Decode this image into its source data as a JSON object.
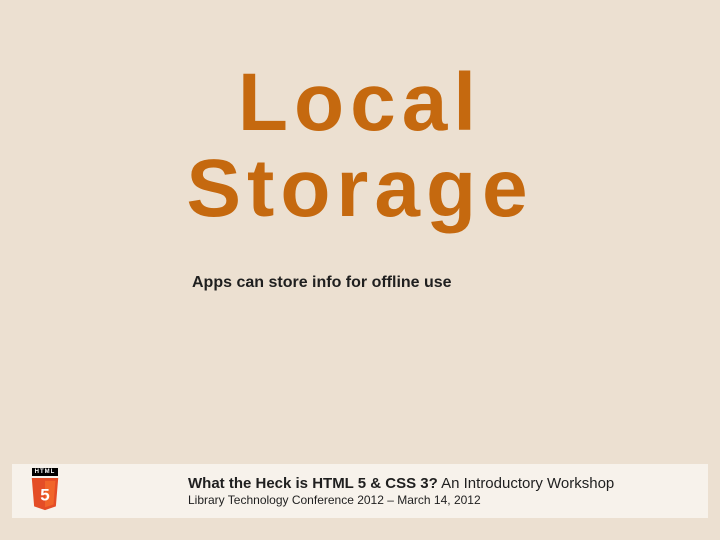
{
  "title": {
    "line1": "Local",
    "line2": "Storage"
  },
  "subtitle": "Apps can store info for offline use",
  "footer": {
    "logo_label": "HTML",
    "logo_number": "5",
    "line1_bold": "What the Heck is HTML 5 & CSS 3?",
    "line1_rest": "  An Introductory Workshop",
    "line2": "Library Technology Conference 2012 – March 14, 2012"
  },
  "colors": {
    "background": "#ece0d1",
    "accent": "#c5690f",
    "footer_bg": "#f7f2eb"
  }
}
